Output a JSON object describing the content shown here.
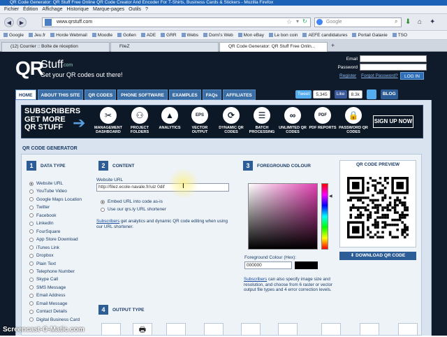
{
  "browser": {
    "title": "QR Code Generator: QR Stuff Free Online QR Code Creator And Encoder For T-Shirts, Business Cards & Stickers - Mozilla Firefox",
    "menu": [
      "Fichier",
      "Édition",
      "Affichage",
      "Historique",
      "Marque-pages",
      "Outils",
      "?"
    ],
    "url": "www.qrstuff.com",
    "search_placeholder": "Google",
    "bookmarks": [
      "Google",
      "Jeu.fr",
      "Horde Webmail",
      "Moodle",
      "Gollen",
      "ADE",
      "GRR",
      "Webs",
      "Domi's Web",
      "Mon eBay",
      "Le bon coin",
      "AEFE candidatures",
      "Portail Galaxie",
      "TSO"
    ],
    "tabs": [
      "(12) Courrier :: Boîte de réception",
      "FileZ",
      "QR Code Generator: QR Stuff Free Onlin..."
    ]
  },
  "site": {
    "logo_qr": "QR",
    "logo_stuff": "Stuff",
    "logo_com": ".com",
    "tagline": "Get your QR codes out there!",
    "login": {
      "email_label": "Email",
      "password_label": "Password",
      "register": "Register",
      "forgot": "Forgot Password?",
      "button": "LOG IN"
    },
    "nav": [
      "HOME",
      "ABOUT THIS SITE",
      "QR CODES",
      "PHONE SOFTWARE",
      "EXAMPLES",
      "FAQs",
      "AFFILIATES"
    ],
    "social": {
      "tweet": "Tweet",
      "tweet_count": "5,345",
      "like": "Like",
      "like_count": "8.3k",
      "blog": "BLOG"
    },
    "banner": {
      "text": "SUBSCRIBERS GET MORE QR STUFF",
      "features": [
        {
          "label": "MANAGEMENT DASHBOARD",
          "icon": "wrench-icon"
        },
        {
          "label": "PROJECT FOLDERS",
          "icon": "folder-icon"
        },
        {
          "label": "ANALYTICS",
          "icon": "chart-icon"
        },
        {
          "label": "VECTOR OUTPUT",
          "icon": "eps-icon"
        },
        {
          "label": "DYNAMIC QR CODES",
          "icon": "refresh-icon"
        },
        {
          "label": "BATCH PROCESSING",
          "icon": "list-icon"
        },
        {
          "label": "UNLIMITED QR CODES",
          "icon": "infinity-icon"
        },
        {
          "label": "PDF REPORTS",
          "icon": "pdf-icon"
        },
        {
          "label": "PASSWORD QR CODES",
          "icon": "lock-icon"
        }
      ],
      "signup": "SIGN UP NOW"
    },
    "generator_title": "QR CODE GENERATOR",
    "step1": {
      "num": "1",
      "label": "DATA TYPE",
      "types": [
        "Website URL",
        "YouTube Video",
        "Google Maps Location",
        "Twitter",
        "Facebook",
        "LinkedIn",
        "FourSquare",
        "App Store Download",
        "iTunes Link",
        "Dropbox",
        "Plain Text",
        "Telephone Number",
        "Skype Call",
        "SMS Message",
        "Email Address",
        "Email Message",
        "Contact Details",
        "Digital Business Card"
      ],
      "selected": 0
    },
    "step2": {
      "num": "2",
      "label": "CONTENT",
      "field_label": "Website URL",
      "url_value": "http://filez.ecole-navale.fr/uiz 0dif",
      "opt1": "Embed URL into code as-is",
      "opt2": "Use our qrs.ly URL shortener",
      "subscribers": "Subscribers",
      "note": " get analytics and dynamic QR code editing when using our URL shortener."
    },
    "step3": {
      "num": "3",
      "label": "FOREGROUND COLOUR",
      "hex_label": "Foreground Colour (Hex):",
      "hex_value": "000000",
      "swatch": "#000000",
      "subscribers": "Subscribers",
      "note": " can also specify image size and resolution, and choose from 6 raster or vector output file types and 4 error correction levels."
    },
    "step4": {
      "num": "4",
      "label": "OUTPUT TYPE"
    },
    "preview": {
      "title": "QR CODE PREVIEW",
      "download": "DOWNLOAD QR CODE"
    }
  },
  "watermark": "Screencast-O-Matic.com",
  "colors": {
    "accent": "#2c5d96",
    "nav": "#3b6ea5",
    "dark": "#0d1826"
  }
}
